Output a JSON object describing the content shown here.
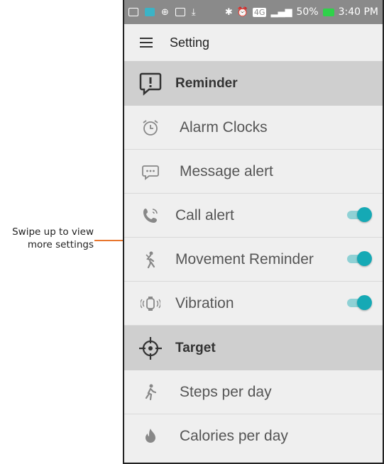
{
  "callout": {
    "line1": "Swipe up to view",
    "line2": "more settings"
  },
  "statusbar": {
    "network": "4G",
    "battery": "50%",
    "time": "3:40 PM"
  },
  "appbar": {
    "title": "Setting"
  },
  "sections": [
    {
      "title": "Reminder",
      "icon": "alert-bubble-icon",
      "items": [
        {
          "label": "Alarm Clocks",
          "icon": "alarm-clock-icon",
          "toggle": null
        },
        {
          "label": "Message alert",
          "icon": "message-icon",
          "toggle": null
        },
        {
          "label": "Call alert",
          "icon": "phone-ringing-icon",
          "toggle": true
        },
        {
          "label": "Movement Reminder",
          "icon": "person-moving-icon",
          "toggle": true
        },
        {
          "label": "Vibration",
          "icon": "vibrate-watch-icon",
          "toggle": true
        }
      ]
    },
    {
      "title": "Target",
      "icon": "crosshair-icon",
      "items": [
        {
          "label": "Steps per day",
          "icon": "walking-icon",
          "toggle": null
        },
        {
          "label": "Calories per day",
          "icon": "flame-icon",
          "toggle": null
        }
      ]
    }
  ],
  "colors": {
    "accent": "#15a9b5",
    "callout": "#e8762d",
    "section_bg": "#cfcfcf",
    "status_bg": "#8a8a8a"
  }
}
